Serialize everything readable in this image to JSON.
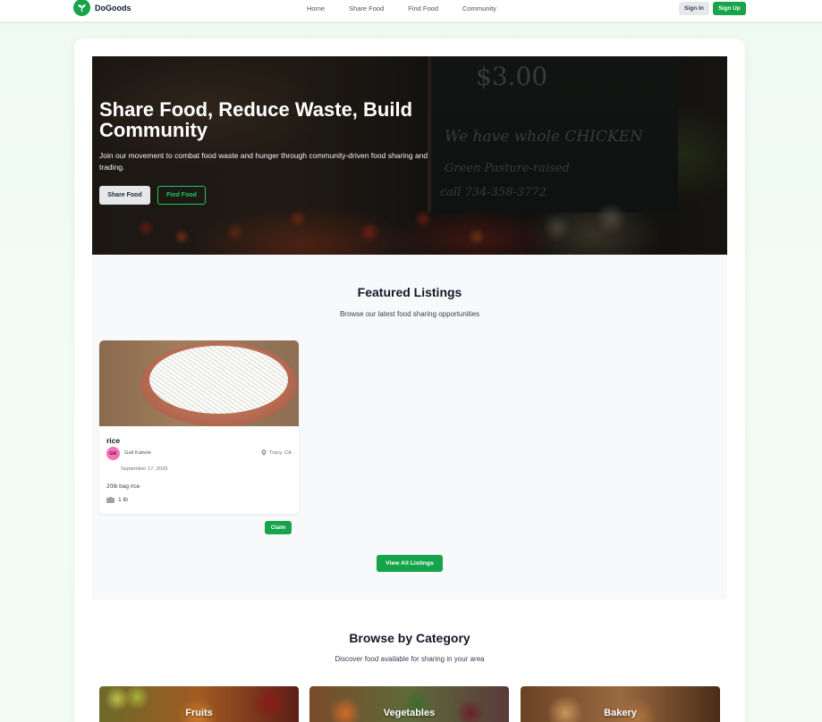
{
  "nav": {
    "brand": "DoGoods",
    "links": [
      "Home",
      "Share Food",
      "Find Food",
      "Community"
    ],
    "sign_in": "Sign In",
    "sign_up": "Sign Up"
  },
  "hero": {
    "title": "Share Food, Reduce Waste, Build Community",
    "subtitle": "Join our movement to combat food waste and hunger through community-driven food sharing and trading.",
    "share_button": "Share Food",
    "find_button": "Find Food",
    "board_text": [
      "$3.00",
      "We have whole CHICKEN",
      "Green Pasture-raised",
      "call 734-358-3772"
    ]
  },
  "featured": {
    "title": "Featured Listings",
    "subtitle": "Browse our latest food sharing opportunities",
    "listings": [
      {
        "name": "rice",
        "owner_initials": "GK",
        "owner_name": "Gail Kahele",
        "location": "Tracy, CA",
        "date": "September 17, 2025",
        "description": "20lb bag rice",
        "quantity": "1 lb",
        "claim": "Claim"
      }
    ],
    "view_all": "View All Listings"
  },
  "categories": {
    "title": "Browse by Category",
    "subtitle": "Discover food available for sharing in your area",
    "items": [
      "Fruits",
      "Vegetables",
      "Bakery"
    ]
  },
  "colors": {
    "brand_green": "#16a34a",
    "avatar_pink": "#f472b6"
  }
}
